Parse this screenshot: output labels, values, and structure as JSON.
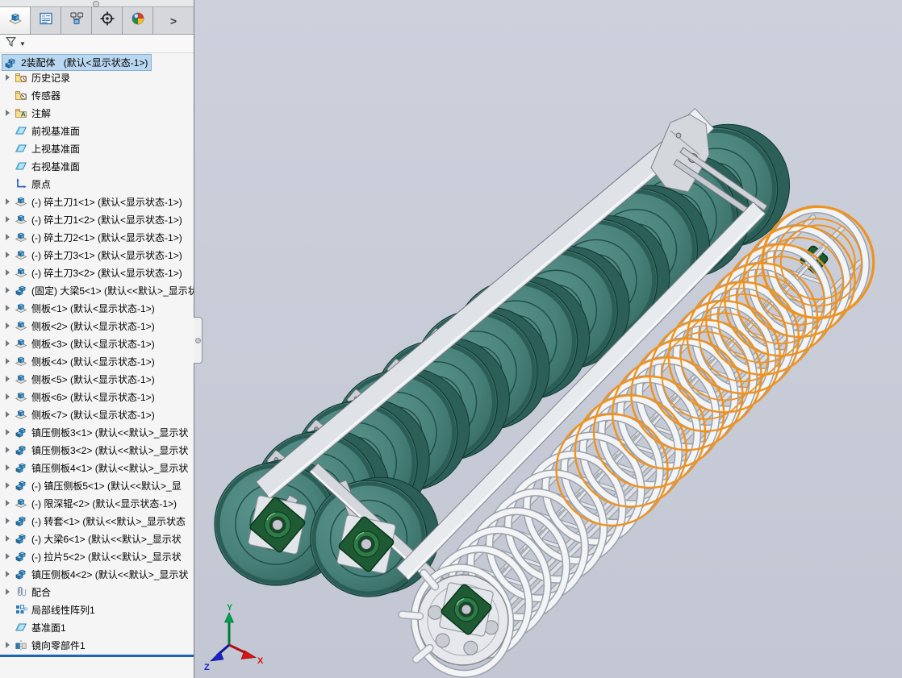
{
  "panel": {
    "tabs": [
      {
        "name": "featuremanager",
        "icon": "featuremanager-tree-icon",
        "active": true
      },
      {
        "name": "propertymanager",
        "icon": "propertymanager-icon",
        "active": false
      },
      {
        "name": "configurationmanager",
        "icon": "configurationmanager-icon",
        "active": false
      },
      {
        "name": "dimxpertmanager",
        "icon": "dimxpert-target-icon",
        "active": false
      },
      {
        "name": "displaymanager",
        "icon": "displaymanager-ball-icon",
        "active": false
      }
    ],
    "tabs_overflow_label": ">",
    "filter": {
      "icon": "filter-funnel-icon",
      "caret": "▼"
    },
    "root": {
      "icon": "assembly-icon",
      "name": "2装配体",
      "config": "(默认<显示状态-1>)"
    },
    "tree_items": [
      {
        "arrow": true,
        "icon": "history-folder",
        "label": "历史记录"
      },
      {
        "arrow": false,
        "icon": "sensors-folder",
        "label": "传感器"
      },
      {
        "arrow": true,
        "icon": "annotations-folder",
        "label": "注解"
      },
      {
        "arrow": false,
        "icon": "plane",
        "label": "前视基准面"
      },
      {
        "arrow": false,
        "icon": "plane",
        "label": "上视基准面"
      },
      {
        "arrow": false,
        "icon": "plane",
        "label": "右视基准面"
      },
      {
        "arrow": false,
        "icon": "origin",
        "label": "原点"
      },
      {
        "arrow": true,
        "icon": "part",
        "label": "(-) 碎土刀1<1> (默认<显示状态-1>)"
      },
      {
        "arrow": true,
        "icon": "part",
        "label": "(-) 碎土刀1<2> (默认<显示状态-1>)"
      },
      {
        "arrow": true,
        "icon": "part",
        "label": "(-) 碎土刀2<1> (默认<显示状态-1>)"
      },
      {
        "arrow": true,
        "icon": "part",
        "label": "(-) 碎土刀3<1> (默认<显示状态-1>)"
      },
      {
        "arrow": true,
        "icon": "part",
        "label": "(-) 碎土刀3<2> (默认<显示状态-1>)"
      },
      {
        "arrow": true,
        "icon": "assembly",
        "label": "(固定) 大梁5<1> (默认<<默认>_显示状"
      },
      {
        "arrow": true,
        "icon": "part",
        "label": "侧板<1> (默认<显示状态-1>)"
      },
      {
        "arrow": true,
        "icon": "part",
        "label": "侧板<2> (默认<显示状态-1>)"
      },
      {
        "arrow": true,
        "icon": "part",
        "label": "侧板<3> (默认<显示状态-1>)"
      },
      {
        "arrow": true,
        "icon": "part",
        "label": "侧板<4> (默认<显示状态-1>)"
      },
      {
        "arrow": true,
        "icon": "part",
        "label": "侧板<5> (默认<显示状态-1>)"
      },
      {
        "arrow": true,
        "icon": "part",
        "label": "侧板<6> (默认<显示状态-1>)"
      },
      {
        "arrow": true,
        "icon": "part",
        "label": "侧板<7> (默认<显示状态-1>)"
      },
      {
        "arrow": true,
        "icon": "assembly",
        "label": "镇压侧板3<1> (默认<<默认>_显示状"
      },
      {
        "arrow": true,
        "icon": "assembly",
        "label": "镇压侧板3<2> (默认<<默认>_显示状"
      },
      {
        "arrow": true,
        "icon": "assembly",
        "label": "镇压侧板4<1> (默认<<默认>_显示状"
      },
      {
        "arrow": true,
        "icon": "assembly",
        "label": "(-) 镇压侧板5<1> (默认<<默认>_显"
      },
      {
        "arrow": true,
        "icon": "part",
        "label": "(-) 限深辊<2> (默认<显示状态-1>)"
      },
      {
        "arrow": true,
        "icon": "assembly",
        "label": "(-) 转套<1> (默认<<默认>_显示状态"
      },
      {
        "arrow": true,
        "icon": "assembly",
        "label": "(-) 大梁6<1> (默认<<默认>_显示状"
      },
      {
        "arrow": true,
        "icon": "assembly",
        "label": "(-) 拉片5<2> (默认<<默认>_显示状"
      },
      {
        "arrow": true,
        "icon": "assembly",
        "label": "镇压侧板4<2> (默认<<默认>_显示状"
      },
      {
        "arrow": true,
        "icon": "mates",
        "label": "配合"
      },
      {
        "arrow": false,
        "icon": "pattern",
        "label": "局部线性阵列1"
      },
      {
        "arrow": false,
        "icon": "plane",
        "label": "基准面1"
      },
      {
        "arrow": true,
        "icon": "mirror",
        "label": "镜向零部件1"
      }
    ]
  },
  "viewport": {
    "triad": {
      "x_label": "X",
      "y_label": "Y",
      "z_label": "Z"
    },
    "colors": {
      "background": "#c7cbd7",
      "disc": "#478179",
      "disc_dark": "#2b5d57",
      "frame": "#dfe2e6",
      "frame_edge": "#70757c",
      "coil": "#f2f4f6",
      "coil_edge": "#9ba1a9",
      "selection_highlight": "#ef9220",
      "bearing_green": "#1e5a33",
      "rollback_bar": "#1f64b4",
      "selected_item_bg": "#b9d7f0",
      "triad_x": "#d81414",
      "triad_y": "#00a14b",
      "triad_z": "#1822c8"
    }
  }
}
